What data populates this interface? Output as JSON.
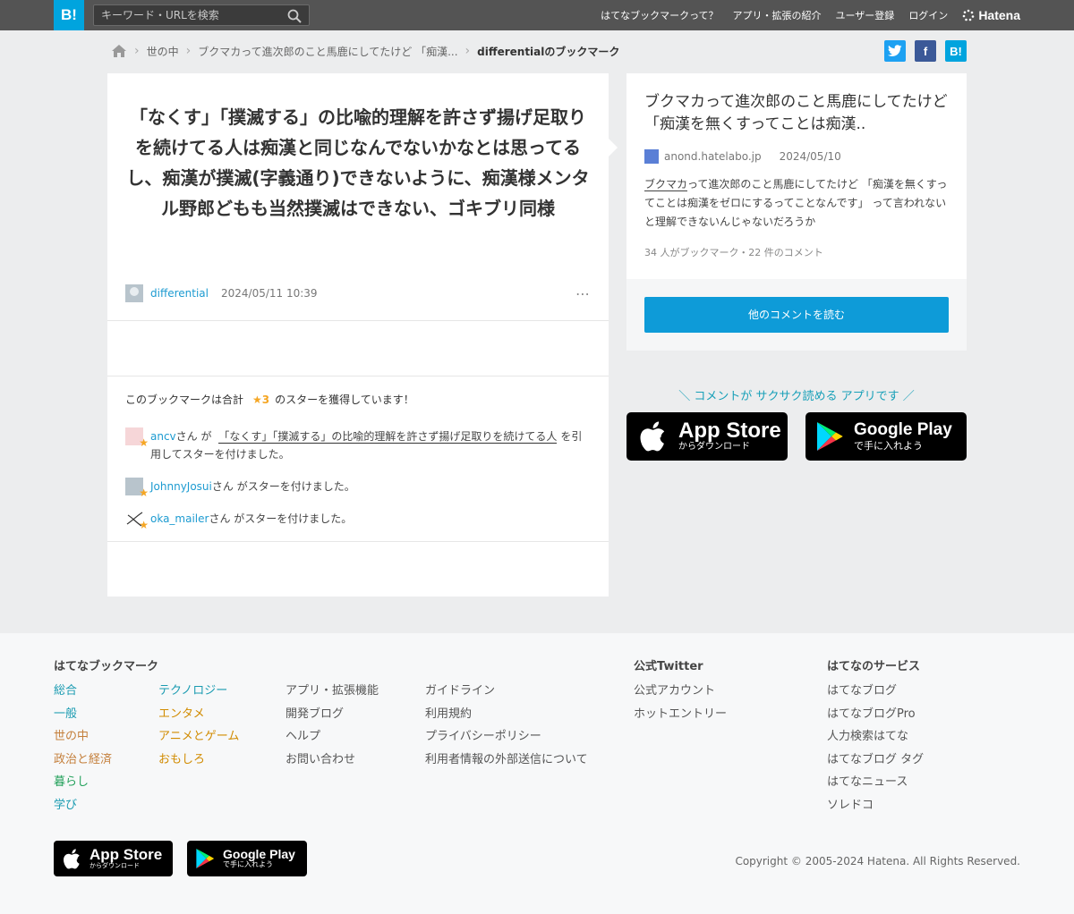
{
  "header": {
    "logo": "B!",
    "search_placeholder": "キーワード・URLを検索",
    "nav": [
      "はてなブックマークって？",
      "アプリ・拡張の紹介",
      "ユーザー登録",
      "ログイン"
    ],
    "brand": "Hatena"
  },
  "breadcrumb": {
    "items": [
      "世の中",
      "ブクマカって進次郎のこと馬鹿にしてたけど 「痴漢...",
      "differentialのブックマーク"
    ]
  },
  "share": {
    "twitter": "t",
    "facebook": "f",
    "hatena": "B!"
  },
  "comment": {
    "text": "「なくす」「撲滅する」の比喩的理解を許さず揚げ足取りを続けてる人は痴漢と同じなんでないかなとは思ってるし、痴漢が撲滅(字義通り)できないように、痴漢様メンタル野郎どもも当然撲滅はできない、ゴキブリ同様",
    "user": "differential",
    "datetime": "2024/05/11 10:39",
    "more": "⋯"
  },
  "stars": {
    "summary_prefix": "このブックマークは合計",
    "count": "★3",
    "summary_suffix": "のスターを獲得しています！",
    "rows": [
      {
        "user": "ancv",
        "pre": "さん が",
        "quote": "「なくす」「撲滅する」の比喩的理解を許さず揚げ足取りを続けてる人",
        "post": "を引用してスターを付けました。"
      },
      {
        "user": "JohnnyJosui",
        "post": "さん がスターを付けました。"
      },
      {
        "user": "oka_mailer",
        "post": "さん がスターを付けました。"
      }
    ]
  },
  "entry": {
    "title": "ブクマカって進次郎のこと馬鹿にしてたけど 「痴漢を無くすってことは痴漢..",
    "domain": "anond.hatelabo.jp",
    "date": "2024/05/10",
    "desc_kw": "ブクマカ",
    "desc_rest": "って進次郎のこと馬鹿にしてたけど 「痴漢を無くすってことは痴漢をゼロにするってことなんです」 って言われないと理解できないんじゃないだろうか",
    "count": "34 人がブックマーク・22 件のコメント",
    "button": "他のコメントを読む"
  },
  "promo": {
    "text": "＼ コメントが サクサク読める アプリです ／",
    "appstore_big": "App Store",
    "appstore_small": "からダウンロード",
    "googleplay_big": "Google Play",
    "googleplay_small": "で手に入れよう"
  },
  "footer": {
    "heading1": "はてなブックマーク",
    "col1": [
      "総合",
      "一般",
      "世の中",
      "政治と経済",
      "暮らし",
      "学び"
    ],
    "col2": [
      "テクノロジー",
      "エンタメ",
      "アニメとゲーム",
      "おもしろ"
    ],
    "col3": [
      "アプリ・拡張機能",
      "開発ブログ",
      "ヘルプ",
      "お問い合わせ"
    ],
    "col4": [
      "ガイドライン",
      "利用規約",
      "プライバシーポリシー",
      "利用者情報の外部送信について"
    ],
    "heading2": "公式Twitter",
    "col5": [
      "公式アカウント",
      "ホットエントリー"
    ],
    "heading3": "はてなのサービス",
    "col6": [
      "はてなブログ",
      "はてなブログPro",
      "人力検索はてな",
      "はてなブログ タグ",
      "はてなニュース",
      "ソレドコ"
    ],
    "copyright": "Copyright © 2005-2024 Hatena. All Rights Reserved."
  },
  "colors": {
    "accent": "#0e9bd8",
    "header_bg": "#545454",
    "logo_bg": "#00a4de",
    "star": "#f5a623"
  }
}
